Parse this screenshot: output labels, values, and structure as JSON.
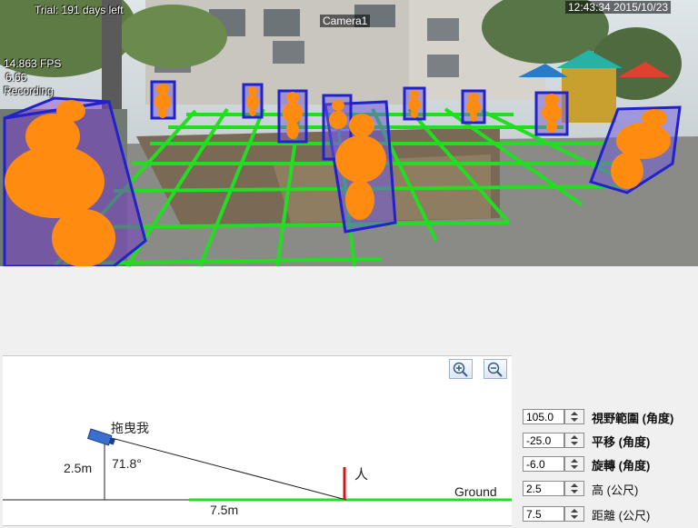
{
  "camera": {
    "trial_text": "Trial: 191 days left",
    "camera_name": "Camera1",
    "timestamp": "12:43:34 2015/10/23",
    "fps": "14.863 FPS",
    "count": "6.66",
    "status": "Recording",
    "grid_color": "#22dd22",
    "box_color": "#2222cc",
    "person_color": "#ff8c10"
  },
  "diagram": {
    "camera_label": "拖曳我",
    "height_label": "2.5m",
    "angle_label": "71.8°",
    "person_label": "人",
    "ground_label": "Ground",
    "distance_label": "7.5m",
    "zoom_in_icon": "zoom-in-icon",
    "zoom_out_icon": "zoom-out-icon"
  },
  "settings": [
    {
      "value": "105.0",
      "label": "視野範圍 (角度)"
    },
    {
      "value": "-25.0",
      "label": "平移 (角度)"
    },
    {
      "value": "-6.0",
      "label": "旋轉 (角度)"
    },
    {
      "value": "2.5",
      "label": "高 (公尺)"
    },
    {
      "value": "7.5",
      "label": "距離 (公尺)"
    }
  ]
}
